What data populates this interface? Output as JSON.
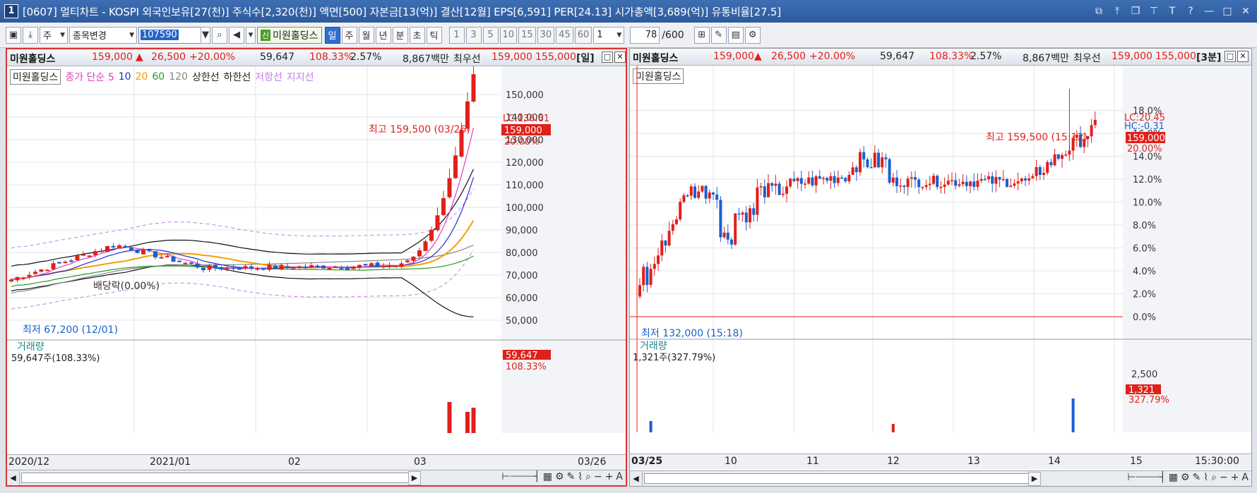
{
  "window": {
    "num": "1",
    "title": "[0607] 멀티차트 - KOSPI 외국인보유[27(천)] 주식수[2,320(천)] 액면[500] 자본금[13(억)] 결산[12월] EPS[6,591] PER[24.13] 시가총액[3,689(억)] 유통비율[27.5]"
  },
  "toolbar": {
    "market": "주",
    "mode": "종목변경",
    "code": "107590",
    "new_badge": "신",
    "stock": "미원홀딩스",
    "periods": [
      "일",
      "주",
      "월",
      "년",
      "분",
      "초",
      "틱"
    ],
    "active_period": "일",
    "intervals": [
      "1",
      "3",
      "5",
      "10",
      "15",
      "30",
      "45",
      "60"
    ],
    "n": "1",
    "count": "78",
    "total": "/600"
  },
  "left": {
    "header": {
      "name": "미원홀딩스",
      "price": "159,000",
      "arrow": "▲",
      "change": "26,500",
      "pct": "+20.00%",
      "volume": "59,647",
      "vol_ratio": "108.33%",
      "turnover": "2.57%",
      "amount": "8,867백만",
      "best": "최우선",
      "bid": "159,000",
      "ask": "155,000",
      "period": "[일]"
    },
    "legend": {
      "name": "미원홀딩스",
      "ma": "종가 단순 5",
      "ma10": "10",
      "ma20": "20",
      "ma60": "60",
      "ma120": "120",
      "upper": "상한선",
      "lower": "하한선",
      "resist": "저항선",
      "support": "지지선"
    },
    "annot_high": "최고 159,500 (03/26)",
    "annot_low": "최저 67,200 (12/01)",
    "annot_div": "배당락(0.00%)",
    "lc": "LC:136.61",
    "cur_tag": "159,000",
    "pct_tag": "20.00%",
    "y_ticks": [
      "150,000",
      "140,000",
      "130,000",
      "120,000",
      "110,000",
      "100,000",
      "90,000",
      "80,000",
      "70,000",
      "60,000",
      "50,000"
    ],
    "vol_title": "거래량",
    "vol_sub": "59,647주(108.33%)",
    "vol_tag": "59,647",
    "vol_tag2": "108.33%",
    "x_labels": [
      "2020/12",
      "2021/01",
      "02",
      "03",
      "03/26"
    ]
  },
  "right": {
    "header": {
      "name": "미원홀딩스",
      "price": "159,000",
      "arrow": "▲",
      "change": "26,500",
      "pct": "+20.00%",
      "volume": "59,647",
      "vol_ratio": "108.33%",
      "turnover": "2.57%",
      "amount": "8,867백만",
      "best": "최우선",
      "bid": "159,000",
      "ask": "155,000",
      "period": "[3분]"
    },
    "legend_name": "미원홀딩스",
    "annot_high": "최고 159,500 (15:12)",
    "annot_low": "최저 132,000 (15:18)",
    "lc": "LC:20.45",
    "hc": "HC:-0.31",
    "cur_tag": "159,000",
    "pct_tag": "20.00%",
    "y_ticks": [
      "18.0%",
      "16.0%",
      "14.0%",
      "12.0%",
      "10.0%",
      "8.0%",
      "6.0%",
      "4.0%",
      "2.0%",
      "0.0%"
    ],
    "vol_title": "거래량",
    "vol_sub": "1,321주(327.79%)",
    "vol_tick": "2,500",
    "vol_tag": "1,321",
    "vol_tag2": "327.79%",
    "x_labels": [
      "03/25",
      "10",
      "11",
      "12",
      "13",
      "14",
      "15",
      "15:30:00"
    ]
  },
  "colors": {
    "up": "#e0201a",
    "down": "#1a5fd0",
    "ma5": "#e040c0",
    "ma10": "#2030d0",
    "ma20": "#f0a000",
    "ma60": "#2a9a2a",
    "ma120": "#888888",
    "band": "#111111",
    "resist": "#c080e0"
  }
}
